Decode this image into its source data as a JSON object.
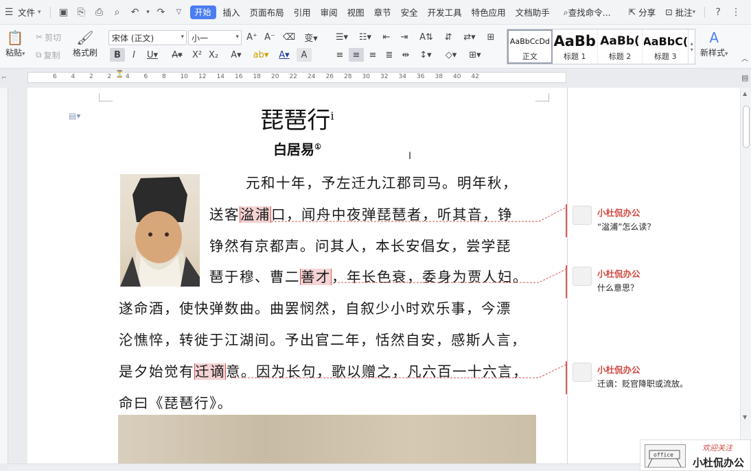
{
  "menubar": {
    "file_label": "文件",
    "tabs": [
      "开始",
      "插入",
      "页面布局",
      "引用",
      "审阅",
      "视图",
      "章节",
      "安全",
      "开发工具",
      "特色应用",
      "文档助手"
    ],
    "active_tab": "开始",
    "search_label": "查找命令...",
    "share_label": "分享",
    "comment_label": "批注",
    "help_label": "?"
  },
  "ribbon": {
    "paste_label": "粘贴",
    "cut_label": "剪切",
    "copy_label": "复制",
    "format_painter_label": "格式刷",
    "font_name": "宋体 (正文)",
    "font_size": "小一",
    "styles": [
      {
        "preview": "AaBbCcDd",
        "name": "正文"
      },
      {
        "preview": "AaBb",
        "name": "标题 1"
      },
      {
        "preview": "AaBb(",
        "name": "标题 2"
      },
      {
        "preview": "AaBbC(",
        "name": "标题 3"
      }
    ],
    "new_style_label": "新样式"
  },
  "ruler": {
    "ticks": [
      "6",
      "4",
      "2",
      "2",
      "4",
      "6",
      "8",
      "10",
      "12",
      "14",
      "16",
      "18",
      "20",
      "22",
      "24",
      "26",
      "28",
      "30",
      "32",
      "34",
      "36",
      "38",
      "40",
      "42"
    ]
  },
  "document": {
    "title": "琵琶行",
    "title_sup": "i",
    "author": "白居易",
    "author_sup": "①",
    "lines": [
      {
        "pre": "元和十年，予左迁九江郡司马。明年秋，",
        "hl": "",
        "post": ""
      },
      {
        "pre": "送客",
        "hl": "湓浦",
        "post": "口，闻舟中夜弹琵琶者，听其音，铮"
      },
      {
        "pre": "铮然有京都声。问其人，本长安倡女，尝学琵",
        "hl": "",
        "post": ""
      },
      {
        "pre": "琶于穆、曹二",
        "hl": "善才",
        "post": "，年长色衰，委身为贾人妇。"
      },
      {
        "pre": "遂命酒，使快弹数曲。曲罢悯然，自叙少小时欢乐事，今漂",
        "hl": "",
        "post": ""
      },
      {
        "pre": "沦憔悴，转徙于江湖间。予出官二年，恬然自安，感斯人言，",
        "hl": "",
        "post": ""
      },
      {
        "pre": "是夕始觉有",
        "hl": "迁谪",
        "post": "意。因为长句，歌以赠之，凡六百一十六言，"
      },
      {
        "pre": "命曰《琵琶行》。",
        "hl": "",
        "post": ""
      }
    ]
  },
  "comments": [
    {
      "author": "小杜侃办公",
      "text": "“湓浦”怎么读？"
    },
    {
      "author": "小杜侃办公",
      "text": "什么意思？"
    },
    {
      "author": "小杜侃办公",
      "text": "迁谪：贬官降职或流放。"
    }
  ],
  "watermark": {
    "line1": "欢迎关注",
    "line2": "小杜侃办公",
    "logo_text": "office"
  },
  "colors": {
    "accent": "#4a7ef0",
    "comment_red": "#d9534f",
    "highlight": "#f4d3d4"
  }
}
